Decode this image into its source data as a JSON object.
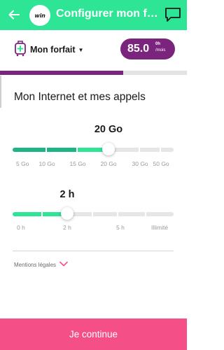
{
  "appbar": {
    "title": "Configurer mon forfait",
    "logo_text": "win",
    "background": "#2ee596"
  },
  "plan": {
    "select_label": "Mon forfait",
    "price_whole": "85.0",
    "price_cents": "0h",
    "price_unit": "/mois",
    "pill_color": "#7b247d"
  },
  "progress": {
    "fraction": 0.66
  },
  "section": {
    "title": "Mon Internet et mes appels"
  },
  "data_slider": {
    "value_label": "20 Go",
    "ticks": [
      "5 Go",
      "10 Go",
      "15 Go",
      "20 Go",
      "30 Go",
      "50 Go"
    ],
    "selected_index": 3
  },
  "calls_slider": {
    "value_label": "2 h",
    "ticks": [
      "0 h",
      "2 h",
      "5 h",
      "Illimité"
    ],
    "selected_index": 1
  },
  "legal": {
    "label": "Mentions légales"
  },
  "cta": {
    "label": "Je continue",
    "color": "#f54f87"
  },
  "icons": [
    "back-arrow-icon",
    "win-logo",
    "chat-icon",
    "plan-suitcase-icon",
    "chevron-down-icon"
  ]
}
